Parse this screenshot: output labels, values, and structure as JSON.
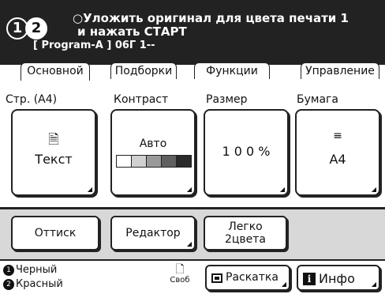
{
  "colors": {
    "header_bg": "#222222",
    "strip_bg": "#d8d8d8",
    "contrast_bar": [
      "#ffffff",
      "#d0d0d0",
      "#9a9a9a",
      "#606060",
      "#2a2a2a"
    ]
  },
  "header": {
    "drum_badges": [
      "1",
      "2"
    ],
    "message_line1": "○Уложить оригинал для цвета печати 1",
    "message_line2": "и нажать СТАРТ",
    "job_line": "[ Program-A ]  06Г   1--"
  },
  "tabs": [
    {
      "label": "Основной",
      "active": true
    },
    {
      "label": "Подборки"
    },
    {
      "label": "Функции"
    },
    {
      "label": "Управление"
    }
  ],
  "settings": {
    "page": {
      "label": "Стр. (A4)",
      "value": "Текст",
      "icon": "document-icon"
    },
    "contrast": {
      "label": "Контраст",
      "value": "Авто",
      "level": 0.5
    },
    "size": {
      "label": "Размер",
      "value": "1 0 0 %"
    },
    "paper": {
      "label": "Бумага",
      "value": "A4",
      "icon": "paper-tray-icon"
    }
  },
  "actions": {
    "proof": "Оттиск",
    "editor": "Редактор",
    "easy_2color_line1": "Легко",
    "easy_2color_line2": "2цвета"
  },
  "footer": {
    "drum1": {
      "num": "1",
      "color": "Черный"
    },
    "drum2": {
      "num": "2",
      "color": "Красный"
    },
    "free_label": "Своб",
    "layout_button": "Раскатка",
    "info_button": "Инфо"
  }
}
